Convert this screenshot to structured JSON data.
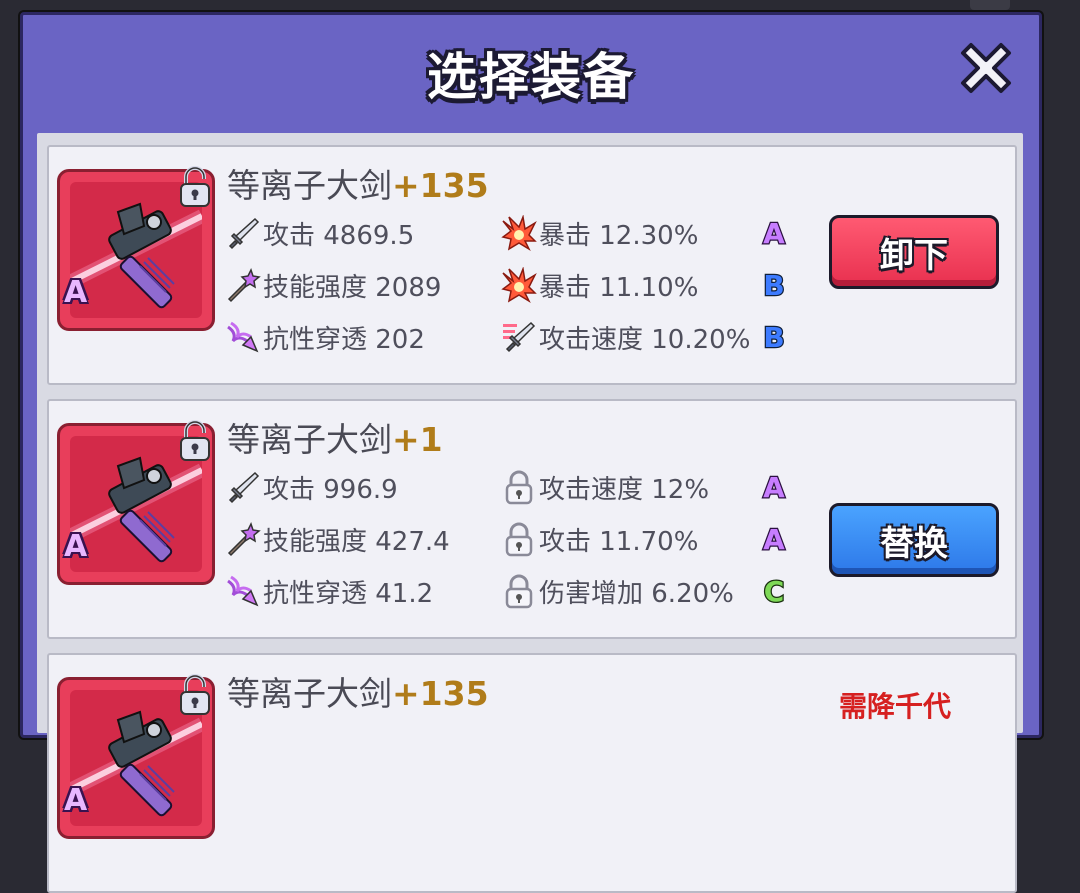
{
  "dialog": {
    "title": "选择装备",
    "close_icon": "close-x-icon"
  },
  "items": [
    {
      "name": "等离子大剑",
      "level": "+135",
      "rarity": "A",
      "lock_state": "unlocked",
      "stats_left": [
        {
          "icon": "sword-icon",
          "label": "攻击 4869.5"
        },
        {
          "icon": "magic-wand-icon",
          "label": "技能强度 2089"
        },
        {
          "icon": "penetration-icon",
          "label": "抗性穿透 202"
        }
      ],
      "stats_right": [
        {
          "icon": "critical-burst-icon",
          "label": "暴击 12.30%",
          "grade": "A"
        },
        {
          "icon": "critical-burst-icon",
          "label": "暴击 11.10%",
          "grade": "B"
        },
        {
          "icon": "attack-speed-icon",
          "label": "攻击速度 10.20%",
          "grade": "B"
        }
      ],
      "action": "卸下"
    },
    {
      "name": "等离子大剑",
      "level": "+1",
      "rarity": "A",
      "lock_state": "unlocked",
      "stats_left": [
        {
          "icon": "sword-icon",
          "label": "攻击 996.9"
        },
        {
          "icon": "magic-wand-icon",
          "label": "技能强度 427.4"
        },
        {
          "icon": "penetration-icon",
          "label": "抗性穿透 41.2"
        }
      ],
      "stats_right": [
        {
          "icon": "locked-stat-icon",
          "label": "攻击速度 12%",
          "grade": "A"
        },
        {
          "icon": "locked-stat-icon",
          "label": "攻击 11.70%",
          "grade": "A"
        },
        {
          "icon": "locked-stat-icon",
          "label": "伤害增加 6.20%",
          "grade": "C"
        }
      ],
      "action": "替换"
    },
    {
      "name": "等离子大剑",
      "level": "+135",
      "rarity": "A",
      "lock_state": "unlocked",
      "requirement": "需降千代"
    }
  ],
  "colors": {
    "header": "#6a64c4",
    "grade_A": "#c77dff",
    "grade_B": "#3d7bff",
    "grade_C": "#7ed957",
    "level_gold": "#b07c1a",
    "unequip_red": "#e8304f",
    "replace_blue": "#2d78e8"
  }
}
